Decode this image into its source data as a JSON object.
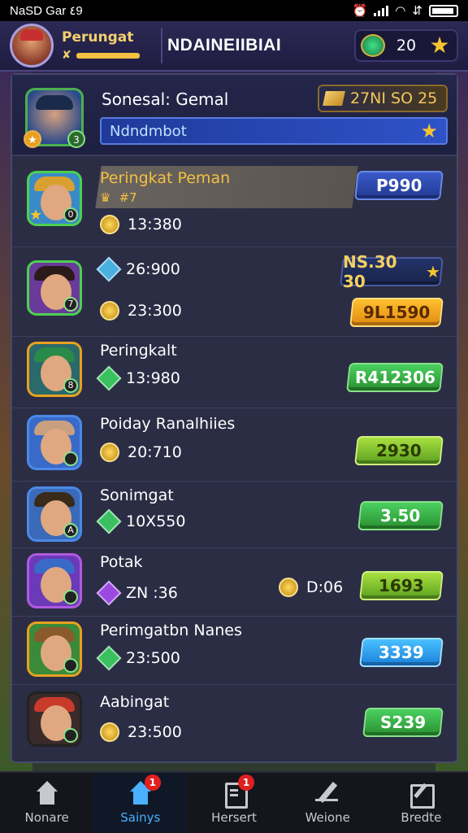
{
  "status_bar": {
    "carrier": "NaSD Gar ٤9"
  },
  "header": {
    "rank_label": "Perungat",
    "rank_icon": "✘",
    "title": "NDAINEIIBIAI",
    "currency_value": "20"
  },
  "profile": {
    "name": "Sonesal: Gemal",
    "level": "3",
    "score": "27NI SO 25",
    "bar_text": "Ndndmbot"
  },
  "rows": [
    {
      "name": "Peringkat Peman",
      "sub": "#7",
      "stat1": "13:380",
      "pill": "P990",
      "level": "0"
    },
    {
      "name": "",
      "stat1": "26:900",
      "stat2": "23:300",
      "pill": "NS.30 30",
      "pill2": "9L1590",
      "level": "7"
    },
    {
      "name": "Peringkalt",
      "stat1": "13:980",
      "pill": "R412306",
      "level": "8"
    },
    {
      "name": "Poiday Ranalhiies",
      "stat1": "20:710",
      "pill": "2930",
      "level": ""
    },
    {
      "name": "Sonimgat",
      "stat1": "10X550",
      "pill": "3.50",
      "level": "A"
    },
    {
      "name": "Potak",
      "stat1": "ZN :36",
      "extra": "D:06",
      "pill": "1693",
      "level": ""
    },
    {
      "name": "Perimgatbn Nanes",
      "stat1": "23:500",
      "pill": "3339",
      "level": ""
    },
    {
      "name": "Aabingat",
      "stat1": "23:500",
      "pill": "S239",
      "level": ""
    }
  ],
  "bottom_nav": [
    {
      "label": "Nonare",
      "icon": "house-icon"
    },
    {
      "label": "Sainys",
      "icon": "house-icon",
      "badge": "1"
    },
    {
      "label": "Hersert",
      "icon": "document-icon",
      "badge": "1"
    },
    {
      "label": "Weione",
      "icon": "pen-icon"
    },
    {
      "label": "Bredte",
      "icon": "edit-icon"
    }
  ],
  "colors": {
    "accent_blue": "#4ab0ff",
    "gold": "#f5c430",
    "panel": "#2b2d45"
  }
}
